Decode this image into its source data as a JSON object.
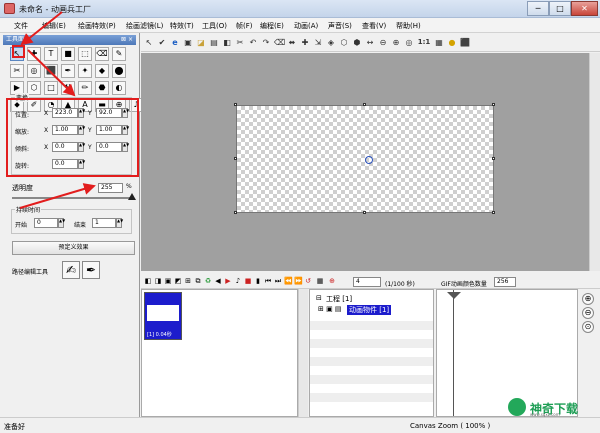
{
  "window": {
    "title": "未命名 - 动画兵工厂",
    "minimize": "─",
    "maximize": "□",
    "close": "✕"
  },
  "menu": [
    "文件",
    "编辑(E)",
    "绘画特效(P)",
    "绘画滤镜(L)",
    "特效(T)",
    "工具(O)",
    "帧(F)",
    "编程(E)",
    "动画(A)",
    "声音(S)",
    "查看(V)",
    "帮助(H)"
  ],
  "tools_panel": {
    "title": "工具面板",
    "close": "⊠ ×",
    "tools": [
      "↖",
      "✚",
      "T",
      "■",
      "⬚",
      "⌫",
      "✎",
      "✂",
      "◎",
      "⬛",
      "✒",
      "✦",
      "◆",
      "⬤",
      "▶",
      "⬡",
      "□",
      "⚒",
      "✏",
      "⬣",
      "◐",
      "⬥",
      "✐",
      "◔",
      "▲",
      "A",
      "▬",
      "⊕",
      "♪"
    ],
    "transform_group": "变换",
    "position_label": "位置:",
    "scale_label": "缩放:",
    "skew_label": "倾斜:",
    "rotation_label": "旋转:",
    "x_axis": "X",
    "y_axis": "Y",
    "position_x": "223.0",
    "position_y": "92.0",
    "scale_x": "1.00",
    "scale_y": "1.00",
    "skew_x": "0.0",
    "skew_y": "0.0",
    "rotation": "0.0",
    "opacity_label": "透明度",
    "opacity_value": "255",
    "opacity_unit": "%",
    "opacity_fraction": 1.0,
    "duration_group": "持续时间",
    "start_label": "开始",
    "start_value": "0",
    "end_label": "结束",
    "end_value": "1",
    "preset_button": "预定义效果",
    "path_label": "路径编辑工具"
  },
  "toolbar_icons": [
    "↖",
    "✔",
    "e",
    "▣",
    "◪",
    "▤",
    "◧",
    "✂",
    "↶",
    "↷",
    "⌫",
    "⬌",
    "✚",
    "⇲",
    "◈",
    "⬡",
    "⬢",
    "↔",
    "⊖",
    "⊕",
    "◎",
    "1:1",
    "▦",
    "●",
    "⬛"
  ],
  "timeline": {
    "icons": [
      "◧",
      "◨",
      "▣",
      "◩",
      "⊞",
      "⧉",
      "♻",
      "◀",
      "▶",
      "♪",
      "■",
      "▮",
      "⏮",
      "⏭",
      "⏪",
      "⏩",
      "↺",
      "▦",
      "⊕"
    ],
    "frame_value": "4",
    "frame_count": "(1/100 秒)",
    "gif_label": "GIF动画颜色数量",
    "gif_value": "256",
    "frame_label": "[1] 0.04秒",
    "tree_root": "工程 [1]",
    "tree_item": "动画物件 [1]"
  },
  "status": {
    "left": "准备好",
    "right": "Canvas Zoom ( 100% )"
  },
  "watermark": {
    "text": "神奇下载",
    "url": "www.sqxz.com"
  },
  "colors": {
    "annotation": "#e21d1d",
    "selection": "#1c1ccc",
    "canvas_bg": "#a0a0a0"
  }
}
